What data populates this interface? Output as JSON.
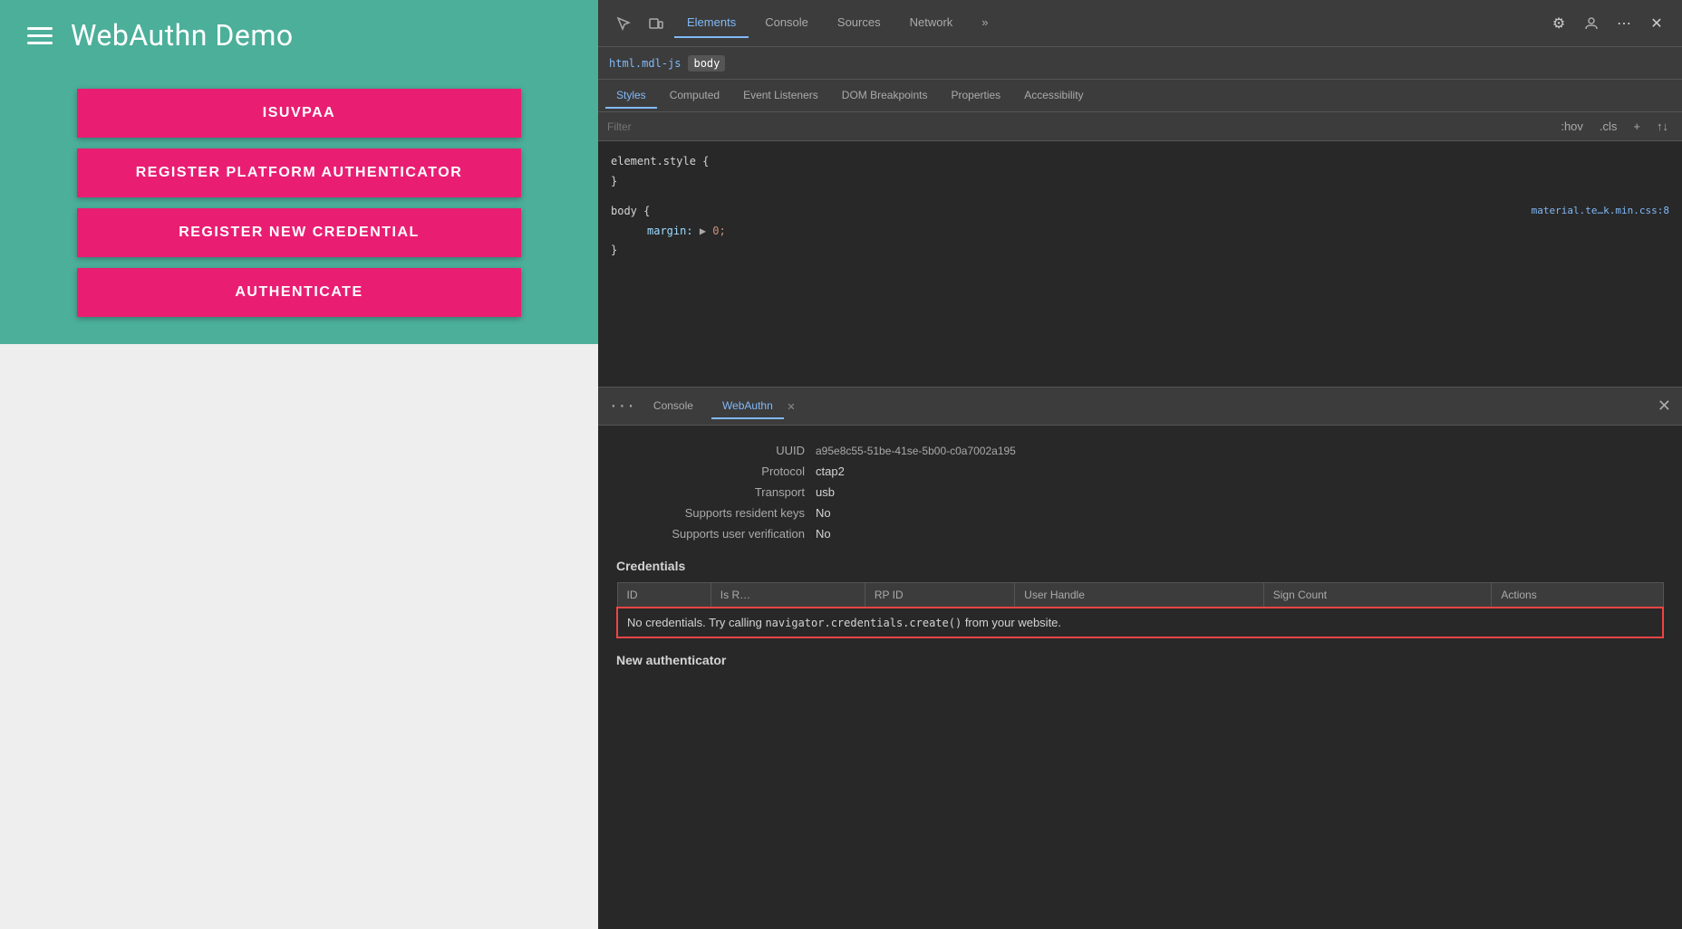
{
  "app": {
    "title": "WebAuthn Demo",
    "header_bg": "#4CAF9A",
    "buttons": [
      {
        "id": "isuvpaa",
        "label": "ISUVPAA"
      },
      {
        "id": "register-platform",
        "label": "REGISTER PLATFORM AUTHENTICATOR"
      },
      {
        "id": "register-credential",
        "label": "REGISTER NEW CREDENTIAL"
      },
      {
        "id": "authenticate",
        "label": "AUTHENTICATE"
      }
    ]
  },
  "devtools": {
    "tabs": [
      {
        "id": "elements",
        "label": "Elements",
        "active": true
      },
      {
        "id": "console",
        "label": "Console",
        "active": false
      },
      {
        "id": "sources",
        "label": "Sources",
        "active": false
      },
      {
        "id": "network",
        "label": "Network",
        "active": false
      },
      {
        "id": "more",
        "label": "»",
        "active": false
      }
    ],
    "breadcrumb": {
      "parent": "html.mdl-js",
      "active": "body"
    },
    "styles": {
      "tabs": [
        "Styles",
        "Computed",
        "Event Listeners",
        "DOM Breakpoints",
        "Properties",
        "Accessibility"
      ],
      "active_tab": "Styles",
      "filter_placeholder": "Filter",
      "filter_buttons": [
        ":hov",
        ".cls",
        "+",
        "↑↓"
      ],
      "rules": [
        {
          "selector": "element.style {",
          "close": "}",
          "properties": [],
          "source": ""
        },
        {
          "selector": "body {",
          "close": "}",
          "properties": [
            {
              "name": "margin:",
              "value": "▶ 0;"
            }
          ],
          "source": "material.te…k.min.css:8"
        }
      ]
    },
    "bottom_panel": {
      "tabs": [
        {
          "id": "ellipsis",
          "label": "···"
        },
        {
          "id": "console",
          "label": "Console",
          "active": false
        },
        {
          "id": "webauthn",
          "label": "WebAuthn",
          "active": true,
          "closeable": true
        }
      ],
      "webauthn": {
        "authenticator": {
          "uuid_label": "UUID",
          "uuid_value": "a95e8c55-51be-41se-5b00-c0a7002a195",
          "protocol_label": "Protocol",
          "protocol_value": "ctap2",
          "transport_label": "Transport",
          "transport_value": "usb",
          "resident_keys_label": "Supports resident keys",
          "resident_keys_value": "No",
          "user_verification_label": "Supports user verification",
          "user_verification_value": "No"
        },
        "credentials": {
          "title": "Credentials",
          "columns": [
            "ID",
            "Is R…",
            "RP ID",
            "User Handle",
            "Sign Count",
            "Actions"
          ],
          "no_credentials_text": "No credentials. Try calling ",
          "no_credentials_code": "navigator.credentials.create()",
          "no_credentials_suffix": " from your website."
        },
        "new_authenticator": {
          "title": "New authenticator"
        }
      }
    }
  }
}
